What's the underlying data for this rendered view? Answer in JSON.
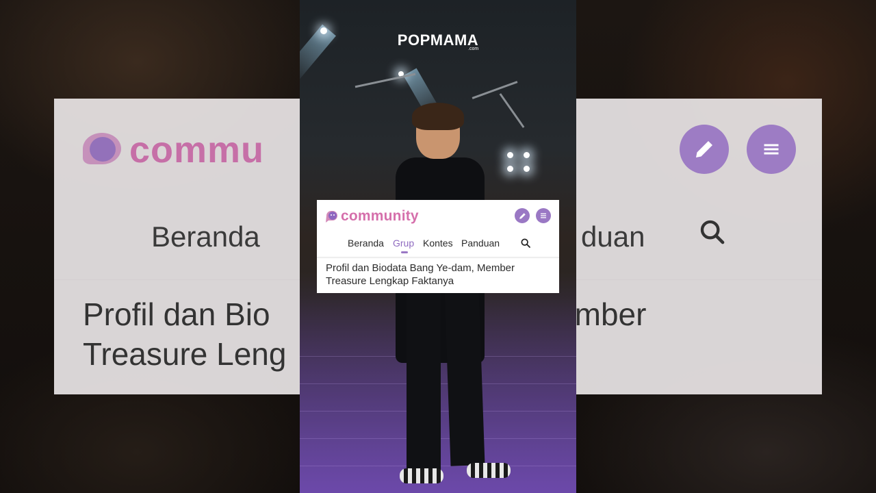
{
  "brand": {
    "name": "POPMAMA",
    "suffix": ".com"
  },
  "community": {
    "logo_text": "community",
    "nav": [
      {
        "label": "Beranda",
        "active": false
      },
      {
        "label": "Grup",
        "active": true
      },
      {
        "label": "Kontes",
        "active": false
      },
      {
        "label": "Panduan",
        "active": false
      }
    ],
    "article_title": "Profil dan Biodata Bang Ye-dam, Member Treasure Lengkap Faktanya",
    "icons": [
      "pencil-icon",
      "menu-icon",
      "search-icon",
      "community-logo-icon"
    ],
    "colors": {
      "accent": "#9a78c4",
      "logo": "#d56fab",
      "active_nav": "#8f6bc0"
    }
  },
  "background_blur": {
    "logo_text": "commu",
    "nav_left": "Beranda",
    "nav_right": "duan",
    "title_line1_left": "Profil dan Bio",
    "title_line1_right": "n, Member",
    "title_line2_left": "Treasure Leng"
  }
}
